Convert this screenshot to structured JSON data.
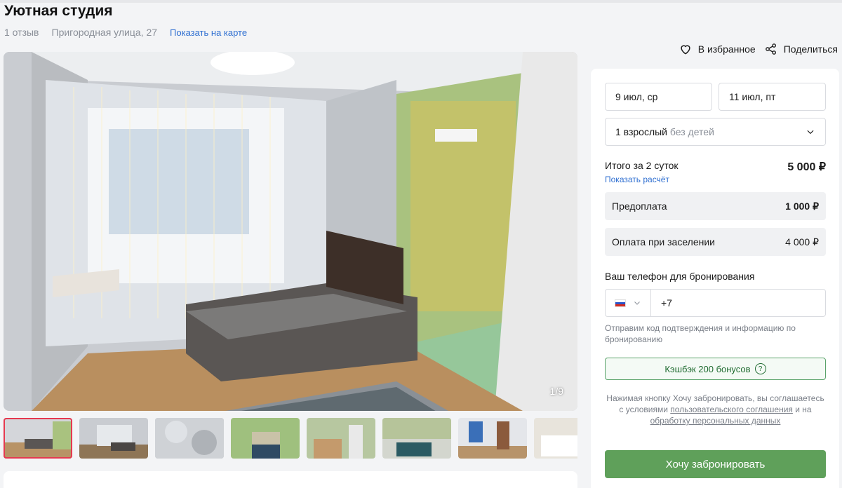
{
  "listing": {
    "title": "Уютная студия",
    "reviews": "1 отзыв",
    "address": "Пригородная улица, 27",
    "map_link": "Показать на карте"
  },
  "actions": {
    "favorite": "В избранное",
    "share": "Поделиться"
  },
  "gallery": {
    "counter": "1/9",
    "thumbnail_count": 8,
    "active_thumbnail": 1
  },
  "booking": {
    "check_in": "9 июл, ср",
    "check_out": "11 июл, пт",
    "guests_main": "1 взрослый",
    "guests_sub": "без детей",
    "total_label": "Итого за 2 суток",
    "total_value": "5 000 ₽",
    "calc_link": "Показать расчёт",
    "prepay_label": "Предоплата",
    "prepay_value": "1 000 ₽",
    "checkin_pay_label": "Оплата при заселении",
    "checkin_pay_value": "4 000 ₽",
    "phone_label": "Ваш телефон для бронирования",
    "phone_prefix": "+7",
    "phone_hint": "Отправим код подтверждения и информацию по бронированию",
    "cashback": "Кэшбэк 200 бонусов",
    "terms_prefix": "Нажимая кнопку Хочу забронировать, вы соглашаетесь с условиями ",
    "terms_link1": "пользовательского соглашения",
    "terms_mid": " и на ",
    "terms_link2": "обработку персональных данных",
    "book_button": "Хочу забронировать"
  },
  "colors": {
    "accent_green": "#5fa05a",
    "link_blue": "#2f6fd1",
    "active_thumb": "#e53950"
  },
  "icons": [
    "heart-icon",
    "share-icon",
    "chevron-down-icon",
    "flag-ru-icon",
    "question-icon"
  ]
}
